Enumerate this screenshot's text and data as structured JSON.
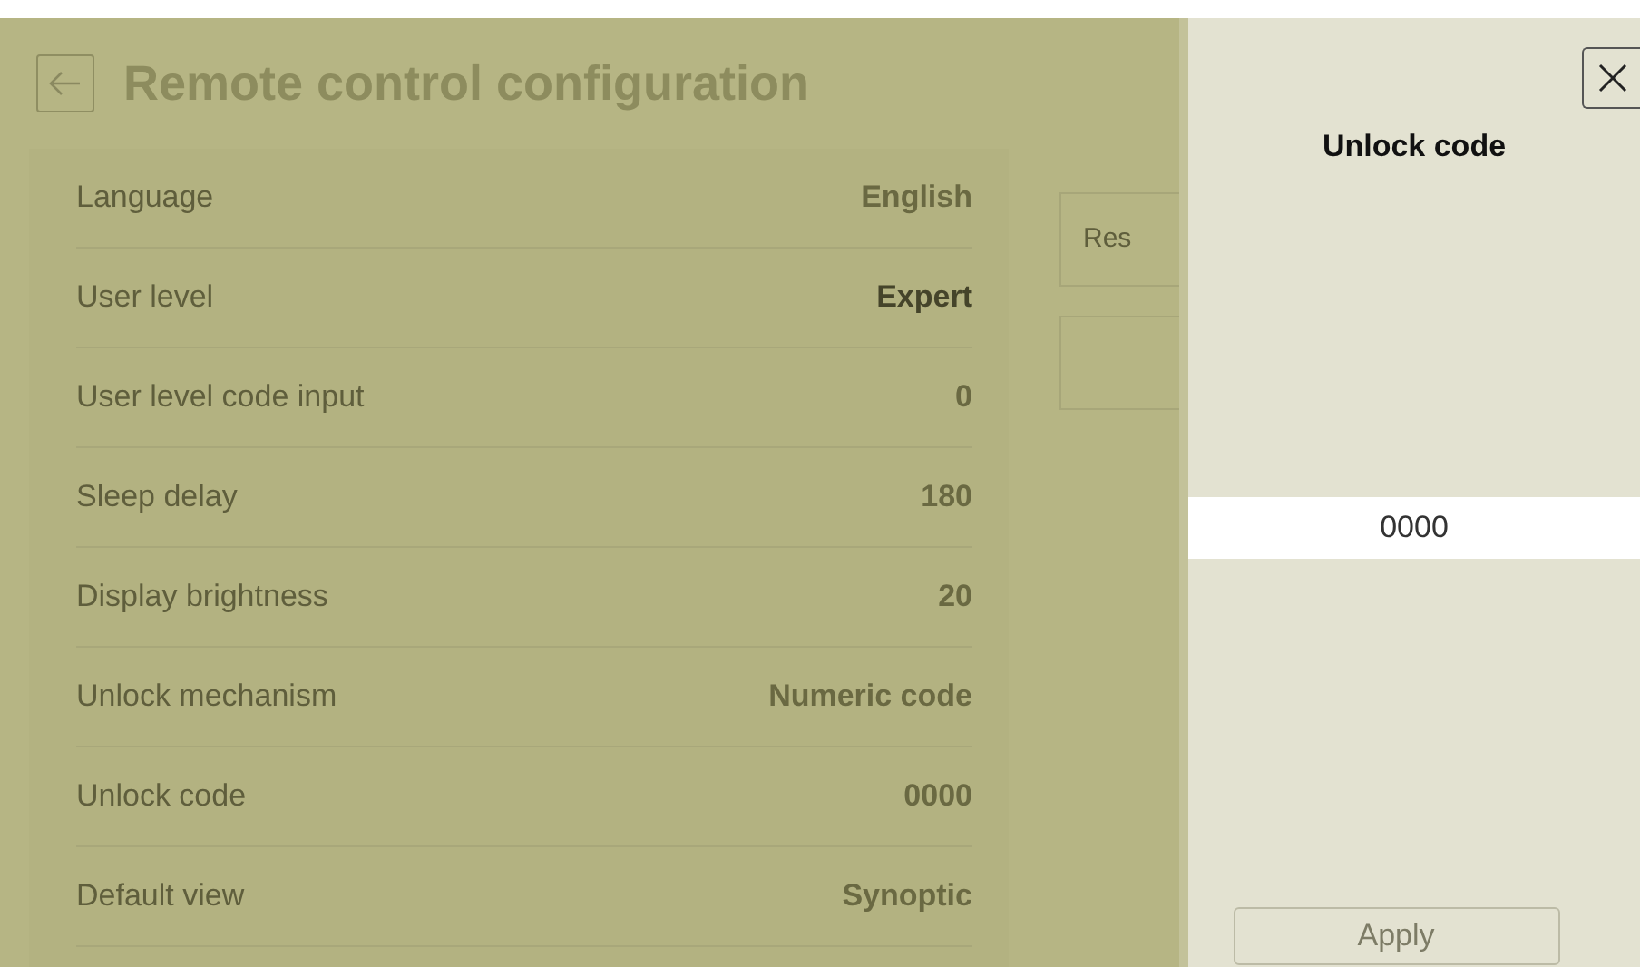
{
  "page": {
    "title": "Remote control configuration"
  },
  "settings": [
    {
      "label": "Language",
      "value": "English",
      "emphasized": false
    },
    {
      "label": "User level",
      "value": "Expert",
      "emphasized": true
    },
    {
      "label": "User level code input",
      "value": "0",
      "emphasized": false
    },
    {
      "label": "Sleep delay",
      "value": "180",
      "emphasized": false
    },
    {
      "label": "Display brightness",
      "value": "20",
      "emphasized": false
    },
    {
      "label": "Unlock mechanism",
      "value": "Numeric code",
      "emphasized": false
    },
    {
      "label": "Unlock code",
      "value": "0000",
      "emphasized": false
    },
    {
      "label": "Default view",
      "value": "Synoptic",
      "emphasized": false
    }
  ],
  "side_buttons": [
    {
      "label": "Res"
    }
  ],
  "dialog": {
    "title": "Unlock code",
    "input_value": "0000",
    "apply": {
      "label": "Apply",
      "disabled": true
    }
  }
}
